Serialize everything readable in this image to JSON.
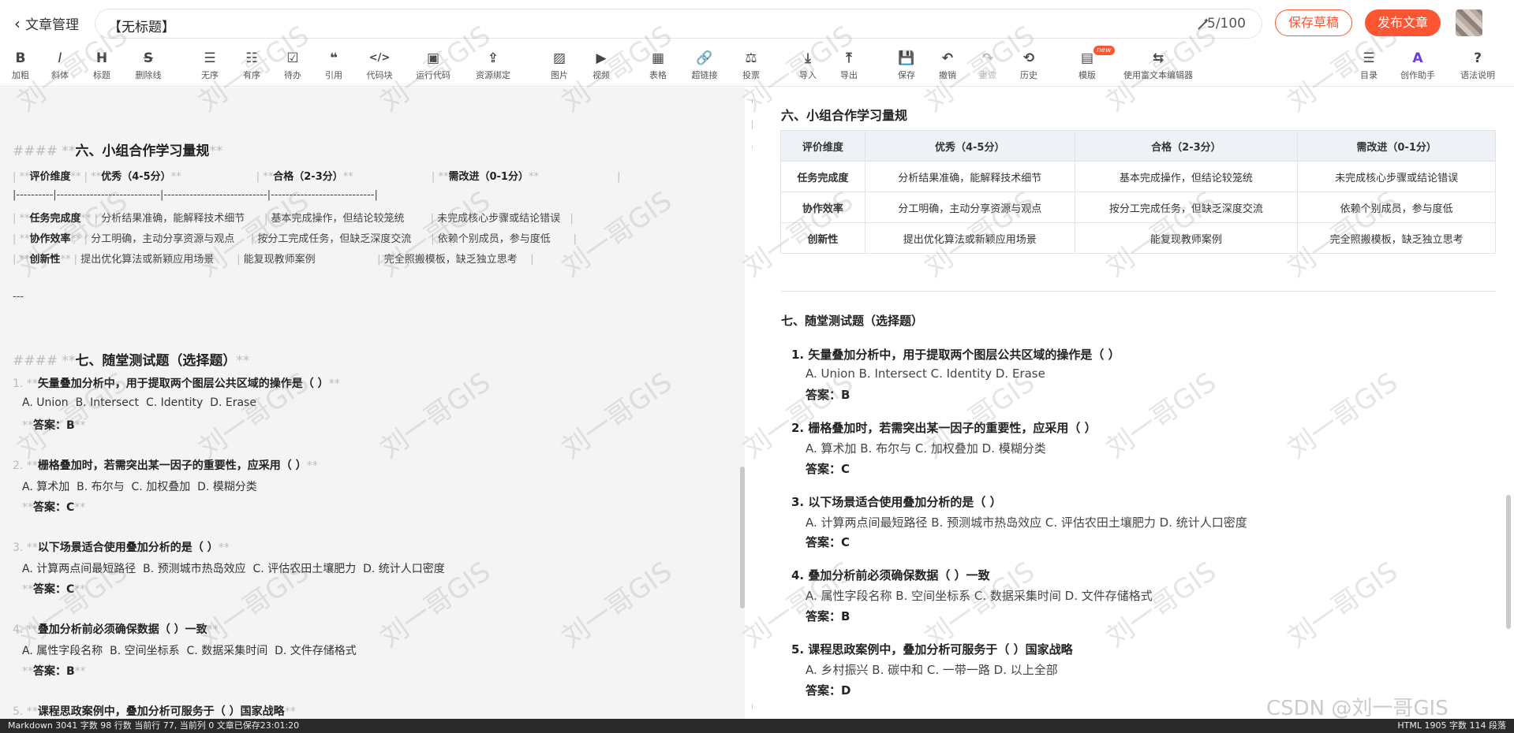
{
  "header": {
    "back_label": "文章管理",
    "title_value": "【无标题】",
    "char_count": "5/100",
    "save_draft": "保存草稿",
    "publish": "发布文章"
  },
  "toolbar": {
    "items": [
      {
        "icon": "B",
        "label": "加粗"
      },
      {
        "icon": "I",
        "label": "斜体"
      },
      {
        "icon": "H",
        "label": "标题"
      },
      {
        "icon": "S",
        "label": "删除线"
      },
      {
        "icon": "☰",
        "label": "无序"
      },
      {
        "icon": "☷",
        "label": "有序"
      },
      {
        "icon": "☑",
        "label": "待办"
      },
      {
        "icon": "❝",
        "label": "引用"
      },
      {
        "icon": "</>",
        "label": "代码块"
      },
      {
        "icon": "▣",
        "label": "运行代码"
      },
      {
        "icon": "⇪",
        "label": "资源绑定"
      },
      {
        "icon": "▨",
        "label": "图片"
      },
      {
        "icon": "▶",
        "label": "视频"
      },
      {
        "icon": "▦",
        "label": "表格"
      },
      {
        "icon": "🔗",
        "label": "超链接"
      },
      {
        "icon": "⚖",
        "label": "投票"
      },
      {
        "icon": "⤓",
        "label": "导入"
      },
      {
        "icon": "⤒",
        "label": "导出"
      },
      {
        "icon": "💾",
        "label": "保存"
      },
      {
        "icon": "↶",
        "label": "撤销"
      },
      {
        "icon": "↷",
        "label": "重做"
      },
      {
        "icon": "⟲",
        "label": "历史"
      },
      {
        "icon": "▤",
        "label": "模版",
        "badge": "new"
      },
      {
        "icon": "⇆",
        "label": "使用富文本编辑器"
      },
      {
        "icon": "☰",
        "label": "目录"
      },
      {
        "icon": "A",
        "label": "创作助手"
      },
      {
        "icon": "?",
        "label": "语法说明"
      }
    ]
  },
  "markdown": {
    "h6_prefix": "#### ",
    "h6_text": "六、小组合作学习量规",
    "table_header": [
      "评价维度",
      "优秀（4-5分）",
      "合格（2-3分）",
      "需改进（0-1分）"
    ],
    "table_sep": "|----------|----------------------------|----------------------------|----------------------------|",
    "rows": [
      [
        "任务完成度",
        "分析结果准确，能解释技术细节",
        "基本完成操作，但结论较笼统",
        "未完成核心步骤或结论错误"
      ],
      [
        "协作效率",
        "分工明确，主动分享资源与观点",
        "按分工完成任务，但缺乏深度交流",
        "依赖个别成员，参与度低"
      ],
      [
        "创新性",
        "提出优化算法或新颖应用场景",
        "能复现教师案例",
        "完全照搬模板，缺乏独立思考"
      ]
    ],
    "hr": "---",
    "h7_text": "七、随堂测试题（选择题）",
    "questions": [
      {
        "num": "1.",
        "q": "矢量叠加分析中，用于提取两个图层公共区域的操作是（ ）",
        "opts": "A. Union  B. Intersect  C. Identity  D. Erase",
        "ans": "答案：B"
      },
      {
        "num": "2.",
        "q": "栅格叠加时，若需突出某一因子的重要性，应采用（ ）",
        "opts": "A. 算术加  B. 布尔与  C. 加权叠加  D. 模糊分类",
        "ans": "答案：C"
      },
      {
        "num": "3.",
        "q": "以下场景适合使用叠加分析的是（ ）",
        "opts": "A. 计算两点间最短路径  B. 预测城市热岛效应  C. 评估农田土壤肥力  D. 统计人口密度",
        "ans": "答案：C"
      },
      {
        "num": "4.",
        "q": "叠加分析前必须确保数据（ ）一致",
        "opts": "A. 属性字段名称  B. 空间坐标系  C. 数据采集时间  D. 文件存储格式",
        "ans": "答案：B"
      },
      {
        "num": "5.",
        "q": "课程思政案例中，叠加分析可服务于（ ）国家战略",
        "opts": "",
        "ans": ""
      }
    ]
  },
  "preview": {
    "h6": "六、小组合作学习量规",
    "table_header": [
      "评价维度",
      "优秀（4-5分）",
      "合格（2-3分）",
      "需改进（0-1分）"
    ],
    "rows": [
      [
        "任务完成度",
        "分析结果准确，能解释技术细节",
        "基本完成操作，但结论较笼统",
        "未完成核心步骤或结论错误"
      ],
      [
        "协作效率",
        "分工明确，主动分享资源与观点",
        "按分工完成任务，但缺乏深度交流",
        "依赖个别成员，参与度低"
      ],
      [
        "创新性",
        "提出优化算法或新颖应用场景",
        "能复现教师案例",
        "完全照搬模板，缺乏独立思考"
      ]
    ],
    "h7": "七、随堂测试题（选择题）",
    "questions": [
      {
        "q": "矢量叠加分析中，用于提取两个图层公共区域的操作是（ ）",
        "opts": "A. Union B. Intersect C. Identity D. Erase",
        "ans": "答案：B"
      },
      {
        "q": "栅格叠加时，若需突出某一因子的重要性，应采用（ ）",
        "opts": "A. 算术加 B. 布尔与 C. 加权叠加 D. 模糊分类",
        "ans": "答案：C"
      },
      {
        "q": "以下场景适合使用叠加分析的是（ ）",
        "opts": "A. 计算两点间最短路径 B. 预测城市热岛效应 C. 评估农田土壤肥力 D. 统计人口密度",
        "ans": "答案：C"
      },
      {
        "q": "叠加分析前必须确保数据（ ）一致",
        "opts": "A. 属性字段名称 B. 空间坐标系 C. 数据采集时间 D. 文件存储格式",
        "ans": "答案：B"
      },
      {
        "q": "课程思政案例中，叠加分析可服务于（ ）国家战略",
        "opts": "A. 乡村振兴 B. 碳中和 C. 一带一路 D. 以上全部",
        "ans": "答案：D"
      }
    ]
  },
  "watermark": "刘一哥GIS",
  "csdn_mark": "CSDN @刘一哥GIS",
  "status": {
    "left": "Markdown  3041 字数  98 行数  当前行 77, 当前列 0  文章已保存23:01:20",
    "right": "HTML  1905 字数  114 段落"
  },
  "colors": {
    "accent": "#fc5531",
    "status_bg": "#2a2a2a",
    "table_head": "#eef1f5"
  }
}
